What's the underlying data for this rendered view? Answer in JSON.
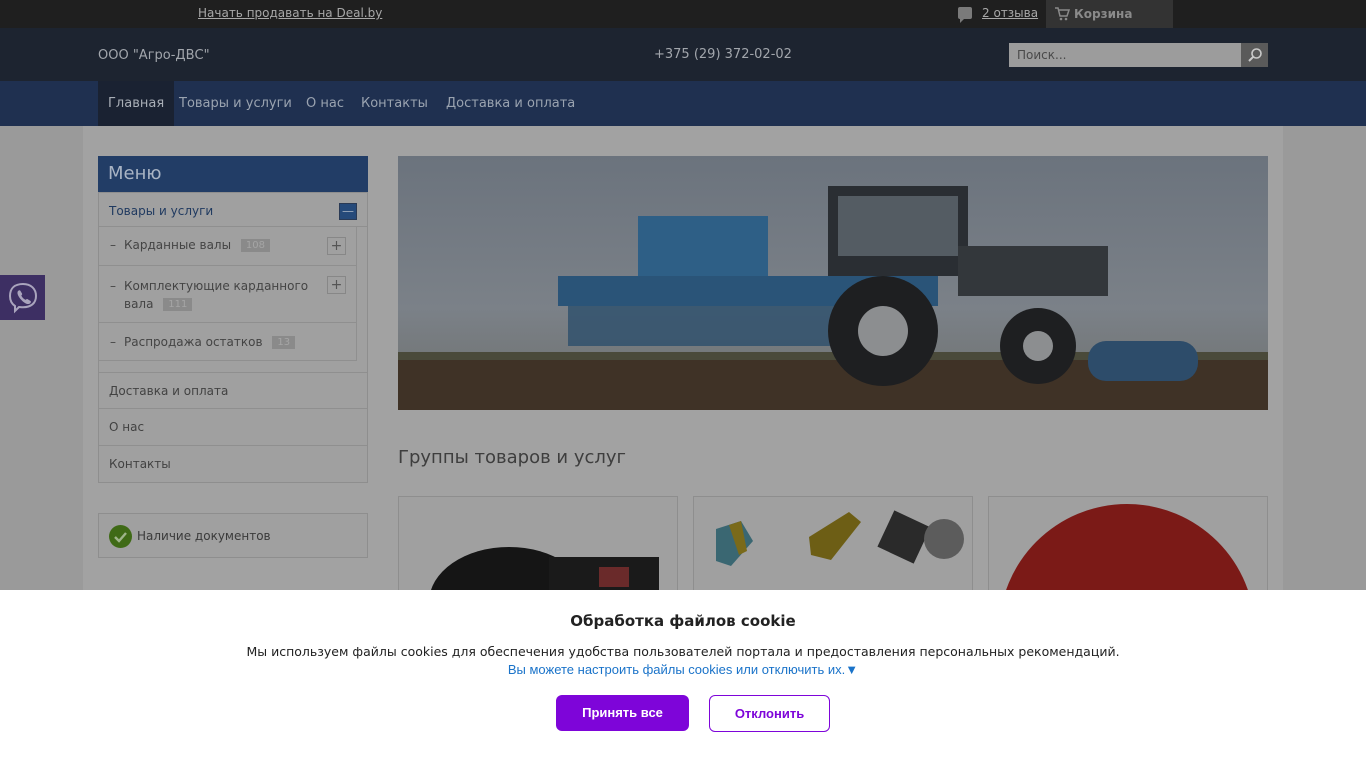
{
  "topbar": {
    "sell_link": "Начать продавать на Deal.by",
    "reviews": "2 отзыва",
    "cart": "Корзина"
  },
  "header": {
    "company": "ООО \"Агро-ДВС\"",
    "phone": "+375 (29) 372-02-02",
    "search_placeholder": "Поиск..."
  },
  "nav": {
    "items": [
      {
        "label": "Главная"
      },
      {
        "label": "Товары и услуги"
      },
      {
        "label": "О нас"
      },
      {
        "label": "Контакты"
      },
      {
        "label": "Доставка и оплата"
      }
    ]
  },
  "sidebar": {
    "title": "Меню",
    "top_item": "Товары и услуги",
    "collapse_symbol": "—",
    "sub_items": [
      {
        "dash": "–",
        "label": "Карданные валы",
        "count": "108"
      },
      {
        "dash": "–",
        "label": "Комплектующие карданного",
        "label2": "вала",
        "count": "111"
      },
      {
        "dash": "–",
        "label": "Распродажа остатков",
        "count": "13"
      }
    ],
    "plus_symbol": "+",
    "items": [
      {
        "label": "Доставка и оплата"
      },
      {
        "label": "О нас"
      },
      {
        "label": "Контакты"
      }
    ],
    "docs": "Наличие документов"
  },
  "main": {
    "section_title": "Группы товаров и услуг"
  },
  "cookie": {
    "title": "Обработка файлов cookie",
    "text": "Мы используем файлы cookies для обеспечения удобства пользователей портала и предоставления персональных рекомендаций.",
    "link": "Вы можете настроить файлы cookies или отключить их.▼",
    "accept": "Принять все",
    "decline": "Отклонить"
  },
  "colors": {
    "accent_purple": "#7e05d9",
    "link_blue": "#1a73c9",
    "menu_blue": "#223d66"
  }
}
